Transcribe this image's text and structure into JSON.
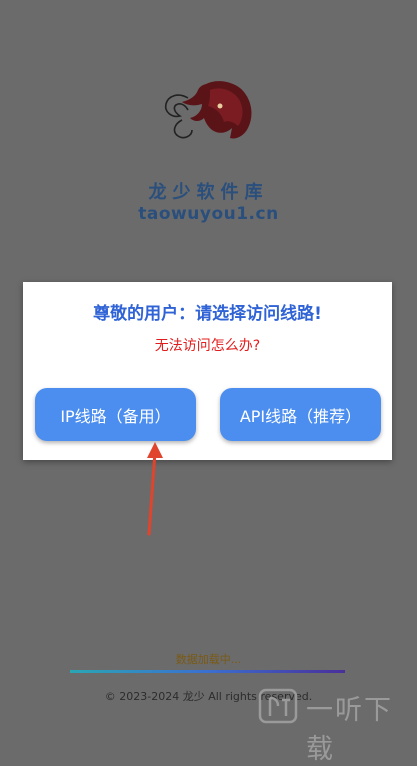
{
  "brand": {
    "name": "龙少软件库",
    "url": "taowuyou1.cn"
  },
  "dialog": {
    "title": "尊敬的用户：请选择访问线路!",
    "help_link": "无法访问怎么办?",
    "buttons": [
      {
        "label": "IP线路（备用）"
      },
      {
        "label": "API线路（推荐）"
      }
    ]
  },
  "loading": {
    "text": "数据加载中...",
    "progress": 1.0
  },
  "footer": {
    "copyright": "© 2023-2024 龙少  All rights reserved."
  },
  "watermark": {
    "text": "一听下载"
  },
  "colors": {
    "overlay_bg": "#6b6b6b",
    "button_blue": "#4b8ef0",
    "title_blue": "#2f63d6",
    "link_red": "#e21c1c",
    "arrow_red": "#e0442c"
  }
}
